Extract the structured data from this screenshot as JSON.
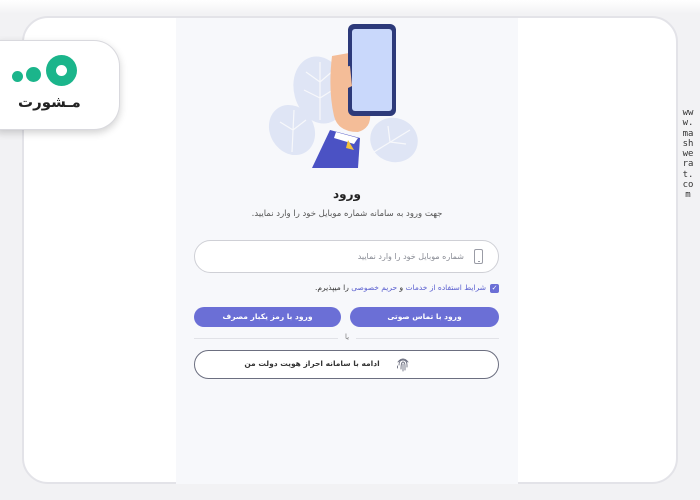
{
  "logo": {
    "text": "مـشورت",
    "brand_color": "#1bb58b"
  },
  "watermark": "www.mashwerat.com",
  "login": {
    "title": "ورود",
    "subtitle": "جهت ورود به سامانه شماره موبایل خود را وارد نمایید.",
    "phone_placeholder": "شماره موبایل خود را وارد نمایید",
    "phone_value": "",
    "phone_icon": "mobile-phone-icon",
    "terms": {
      "checked": true,
      "link_terms": "شرایط استفاده از خدمات",
      "and": "و",
      "link_privacy": "حریم خصوصی",
      "suffix": "را میپذیرم."
    },
    "btn_voice": "ورود با تماس صوتی",
    "btn_otp": "ورود با رمز یکبار مصرف",
    "divider": "یا",
    "btn_gov": "ادامه با سامانه احراز هویت دولت من",
    "gov_icon": "fingerprint-icon",
    "accent_color": "#6b6fd6"
  }
}
